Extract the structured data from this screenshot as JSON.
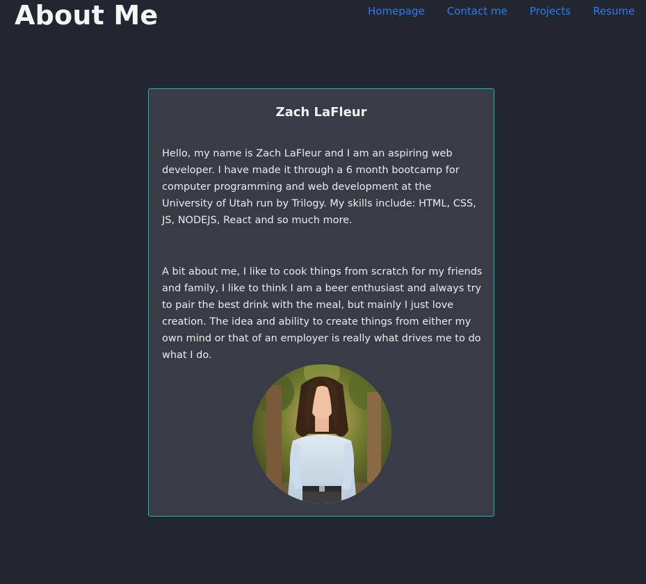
{
  "header": {
    "title": "About Me",
    "nav": [
      "Homepage",
      "Contact me",
      "Projects",
      "Resume"
    ]
  },
  "card": {
    "name": "Zach LaFleur",
    "paragraph_1": "Hello, my name is Zach LaFleur and I am an aspiring web developer. I have made it through a 6 month bootcamp for computer programming and web development at the University of Utah run by Trilogy. My skills include: HTML, CSS, JS, NODEJS, React and so much more.",
    "paragraph_2": "A bit about me, I like to cook things from scratch for my friends and family, I like to think I am a beer enthusiast and always try to pair the best drink with the meal, but mainly I just love creation. The idea and ability to create things from either my own mind or that of an employer is really what drives me to do what I do."
  },
  "colors": {
    "background": "#212630",
    "card": "#373c46",
    "card_border": "#1fb8b8",
    "link": "#2d7cf0"
  }
}
